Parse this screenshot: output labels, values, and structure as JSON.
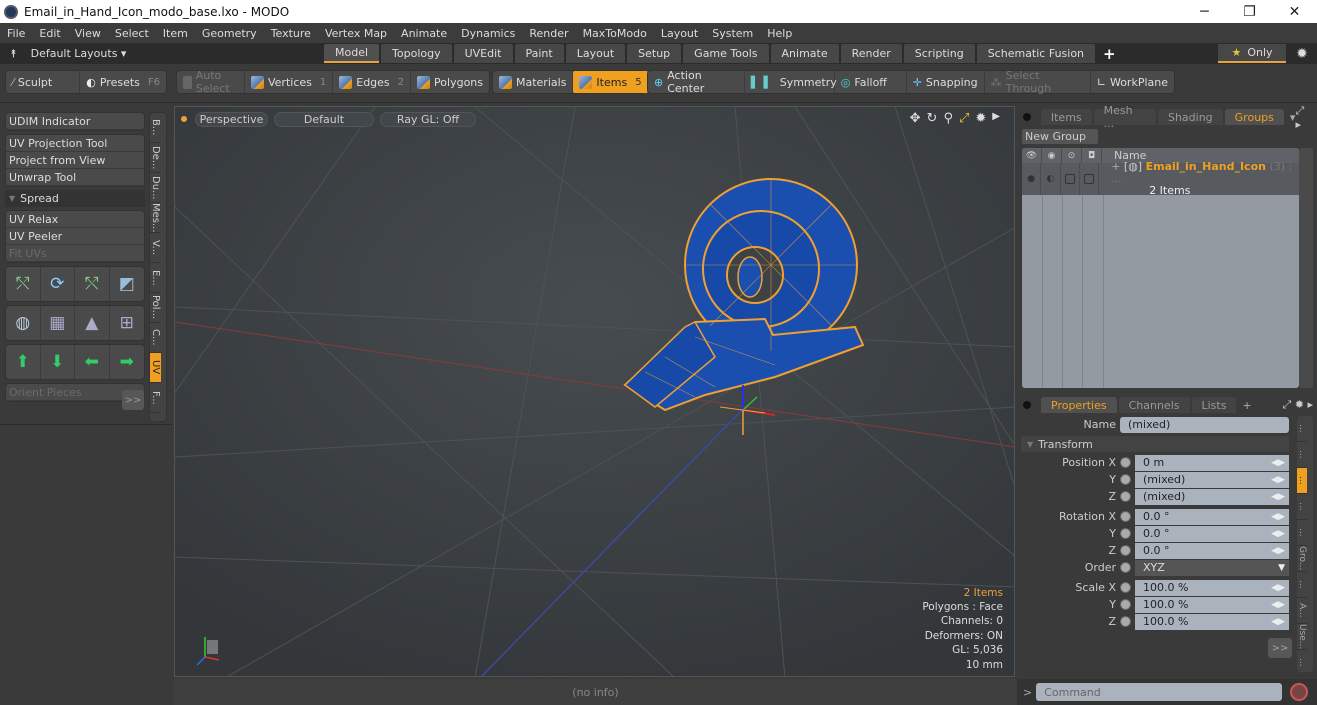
{
  "window": {
    "title": "Email_in_Hand_Icon_modo_base.lxo - MODO",
    "minimize": "─",
    "maximize": "❐",
    "close": "✕"
  },
  "menu": [
    "File",
    "Edit",
    "View",
    "Select",
    "Item",
    "Geometry",
    "Texture",
    "Vertex Map",
    "Animate",
    "Dynamics",
    "Render",
    "MaxToModo",
    "Layout",
    "System",
    "Help"
  ],
  "layouts": {
    "label": "Default Layouts ▾",
    "tabs": [
      "Model",
      "Topology",
      "UVEdit",
      "Paint",
      "Layout",
      "Setup",
      "Game Tools",
      "Animate",
      "Render",
      "Scripting",
      "Schematic Fusion"
    ],
    "active": "Model",
    "add": "+",
    "only": "Only"
  },
  "toolbar": {
    "sculpt": "Sculpt",
    "presets": "Presets",
    "presets_key": "F6",
    "auto_select": "Auto Select",
    "vertices": "Vertices",
    "vertices_key": "1",
    "edges": "Edges",
    "edges_key": "2",
    "polygons": "Polygons",
    "materials": "Materials",
    "items": "Items",
    "items_key": "5",
    "action_center": "Action Center",
    "symmetry": "Symmetry",
    "falloff": "Falloff",
    "snapping": "Snapping",
    "select_through": "Select Through",
    "workplane": "WorkPlane"
  },
  "left_panel": {
    "udim": "UDIM Indicator",
    "tools1": [
      "UV Projection Tool",
      "Project from View",
      "Unwrap Tool"
    ],
    "spread": "Spread",
    "tools2": [
      "UV Relax",
      "UV Peeler",
      "Fit UVs"
    ],
    "orient": "Orient Pieces",
    "more": ">>",
    "vtabs": [
      "B...",
      "De...",
      "Du...",
      "Mes...",
      "V...",
      "E...",
      "Pol...",
      "C...",
      "UV",
      "F..."
    ],
    "active_vtab": "UV"
  },
  "viewport": {
    "view": "Perspective",
    "shading": "Default",
    "raygl": "Ray GL: Off",
    "stats": {
      "items": "2 Items",
      "polygons": "Polygons : Face",
      "channels": "Channels: 0",
      "deformers": "Deformers: ON",
      "gl": "GL: 5,036",
      "scale": "10 mm"
    }
  },
  "status": "(no info)",
  "right_panel": {
    "tabs": [
      "Items",
      "Mesh ...",
      "Shading",
      "Groups"
    ],
    "active_tab": "Groups",
    "new_group": "New Group",
    "col_name": "Name",
    "group": {
      "name": "Email_in_Hand_Icon",
      "suffix": "(3) : ...",
      "count": "2 Items"
    },
    "prop_tabs": [
      "Properties",
      "Channels",
      "Lists",
      "+"
    ],
    "active_prop_tab": "Properties",
    "name_label": "Name",
    "name_value": "(mixed)",
    "transform": "Transform",
    "position": [
      {
        "label": "Position X",
        "value": "0 m"
      },
      {
        "label": "Y",
        "value": "(mixed)"
      },
      {
        "label": "Z",
        "value": "(mixed)"
      }
    ],
    "rotation": [
      {
        "label": "Rotation X",
        "value": "0.0 °"
      },
      {
        "label": "Y",
        "value": "0.0 °"
      },
      {
        "label": "Z",
        "value": "0.0 °"
      }
    ],
    "order": {
      "label": "Order",
      "value": "XYZ"
    },
    "scale": [
      {
        "label": "Scale X",
        "value": "100.0 %"
      },
      {
        "label": "Y",
        "value": "100.0 %"
      },
      {
        "label": "Z",
        "value": "100.0 %"
      }
    ],
    "more": ">>",
    "rvtabs": [
      "...",
      "...",
      "...",
      "...",
      "...",
      "Gro...",
      "...",
      "A...",
      "Use...",
      "..."
    ],
    "command_placeholder": "Command",
    "command_prompt": ">"
  },
  "colors": {
    "accent": "#f0a020",
    "mesh_fill": "#1a4fb0",
    "wire": "#f0a030"
  }
}
